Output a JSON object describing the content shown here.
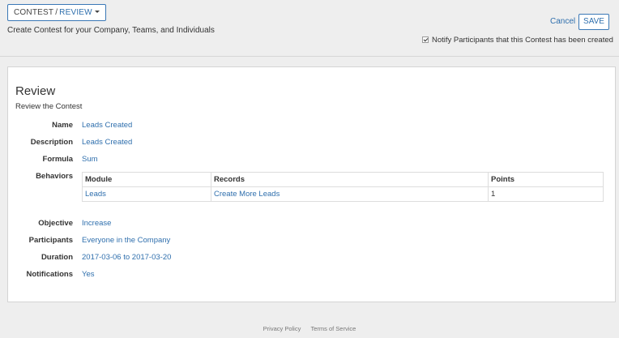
{
  "header": {
    "breadcrumb": {
      "part1": "CONTEST",
      "separator": "/",
      "part2": "REVIEW"
    },
    "subtitle": "Create Contest for your Company, Teams, and Individuals",
    "cancel_label": "Cancel",
    "save_label": "SAVE",
    "notify": {
      "checked": true,
      "label": "Notify Participants that this Contest has been created"
    }
  },
  "review": {
    "title": "Review",
    "subtitle": "Review the Contest",
    "fields": {
      "name": {
        "label": "Name",
        "value": "Leads Created"
      },
      "description": {
        "label": "Description",
        "value": "Leads Created"
      },
      "formula": {
        "label": "Formula",
        "value": "Sum"
      },
      "behaviors": {
        "label": "Behaviors"
      },
      "objective": {
        "label": "Objective",
        "value": "Increase"
      },
      "participants": {
        "label": "Participants",
        "value": "Everyone in the Company"
      },
      "duration": {
        "label": "Duration",
        "value": "2017-03-06 to 2017-03-20"
      },
      "notifications": {
        "label": "Notifications",
        "value": "Yes"
      }
    },
    "behaviors_table": {
      "columns": [
        "Module",
        "Records",
        "Points"
      ],
      "rows": [
        [
          "Leads",
          "Create More Leads",
          "1"
        ]
      ]
    }
  },
  "footer": {
    "privacy": "Privacy Policy",
    "terms": "Terms of Service"
  },
  "colors": {
    "link": "#2f6fad",
    "background": "#eeeeee",
    "card": "#ffffff"
  }
}
